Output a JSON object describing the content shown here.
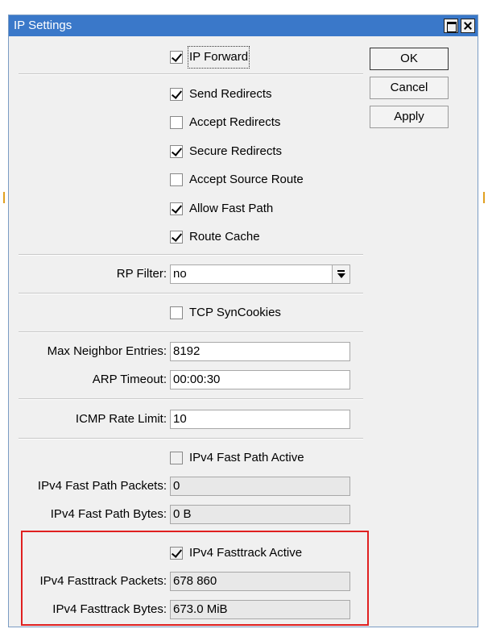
{
  "window": {
    "title": "IP Settings"
  },
  "buttons": {
    "ok": "OK",
    "cancel": "Cancel",
    "apply": "Apply"
  },
  "checkboxes": {
    "ip_forward": {
      "label": "IP Forward",
      "checked": true
    },
    "send_redirects": {
      "label": "Send Redirects",
      "checked": true
    },
    "accept_redirects": {
      "label": "Accept Redirects",
      "checked": false
    },
    "secure_redirects": {
      "label": "Secure Redirects",
      "checked": true
    },
    "accept_source_route": {
      "label": "Accept Source Route",
      "checked": false
    },
    "allow_fast_path": {
      "label": "Allow Fast Path",
      "checked": true
    },
    "route_cache": {
      "label": "Route Cache",
      "checked": true
    },
    "tcp_syncookies": {
      "label": "TCP SynCookies",
      "checked": false
    },
    "ipv4_fast_path_active": {
      "label": "IPv4 Fast Path Active",
      "checked": false
    },
    "ipv4_fasttrack_active": {
      "label": "IPv4 Fasttrack Active",
      "checked": true
    }
  },
  "fields": {
    "rp_filter": {
      "label": "RP Filter:",
      "value": "no"
    },
    "max_neighbor_entries": {
      "label": "Max Neighbor Entries:",
      "value": "8192"
    },
    "arp_timeout": {
      "label": "ARP Timeout:",
      "value": "00:00:30"
    },
    "icmp_rate_limit": {
      "label": "ICMP Rate Limit:",
      "value": "10"
    },
    "ipv4_fast_path_packets": {
      "label": "IPv4 Fast Path Packets:",
      "value": "0"
    },
    "ipv4_fast_path_bytes": {
      "label": "IPv4 Fast Path Bytes:",
      "value": "0 B"
    },
    "ipv4_fasttrack_packets": {
      "label": "IPv4 Fasttrack Packets:",
      "value": "678 860"
    },
    "ipv4_fasttrack_bytes": {
      "label": "IPv4 Fasttrack Bytes:",
      "value": "673.0 MiB"
    }
  },
  "colors": {
    "titlebar": "#3a78c9",
    "highlight": "#e02020"
  }
}
